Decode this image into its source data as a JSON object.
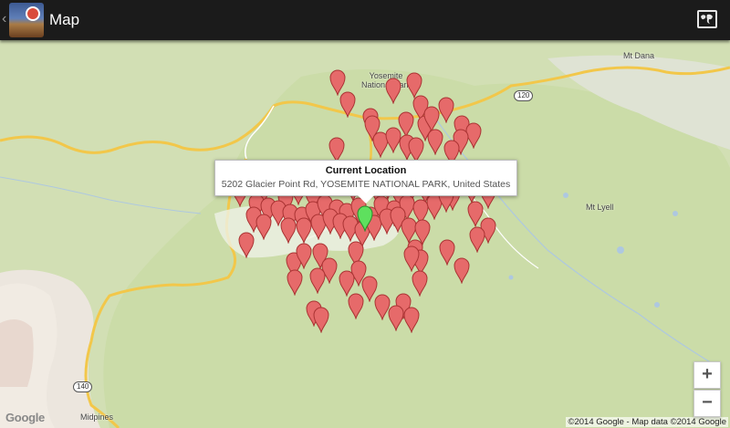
{
  "action_bar": {
    "back_glyph": "‹",
    "title": "Map",
    "world_icon": "map-view-icon"
  },
  "map": {
    "labels": {
      "yosemite": "Yosemite National Park",
      "yosemite_line1": "Yosemite",
      "yosemite_line2": "National Park",
      "mt_dana": "Mt Dana",
      "mt_lyell": "Mt Lyell",
      "midpines": "Midpines",
      "hwy_120": "120",
      "hwy_140": "140"
    },
    "info_window": {
      "title": "Current Location",
      "address": "5202 Glacier Point Rd, YOSEMITE NATIONAL PARK, United States"
    },
    "zoom_in": "+",
    "zoom_out": "−",
    "google_logo": "Google",
    "attribution": "©2014 Google - Map data ©2014 Google",
    "colors": {
      "pin_red": "#e66a6a",
      "pin_green": "#5ee05e",
      "road": "#f5c84a",
      "park": "#cfdfae"
    }
  }
}
